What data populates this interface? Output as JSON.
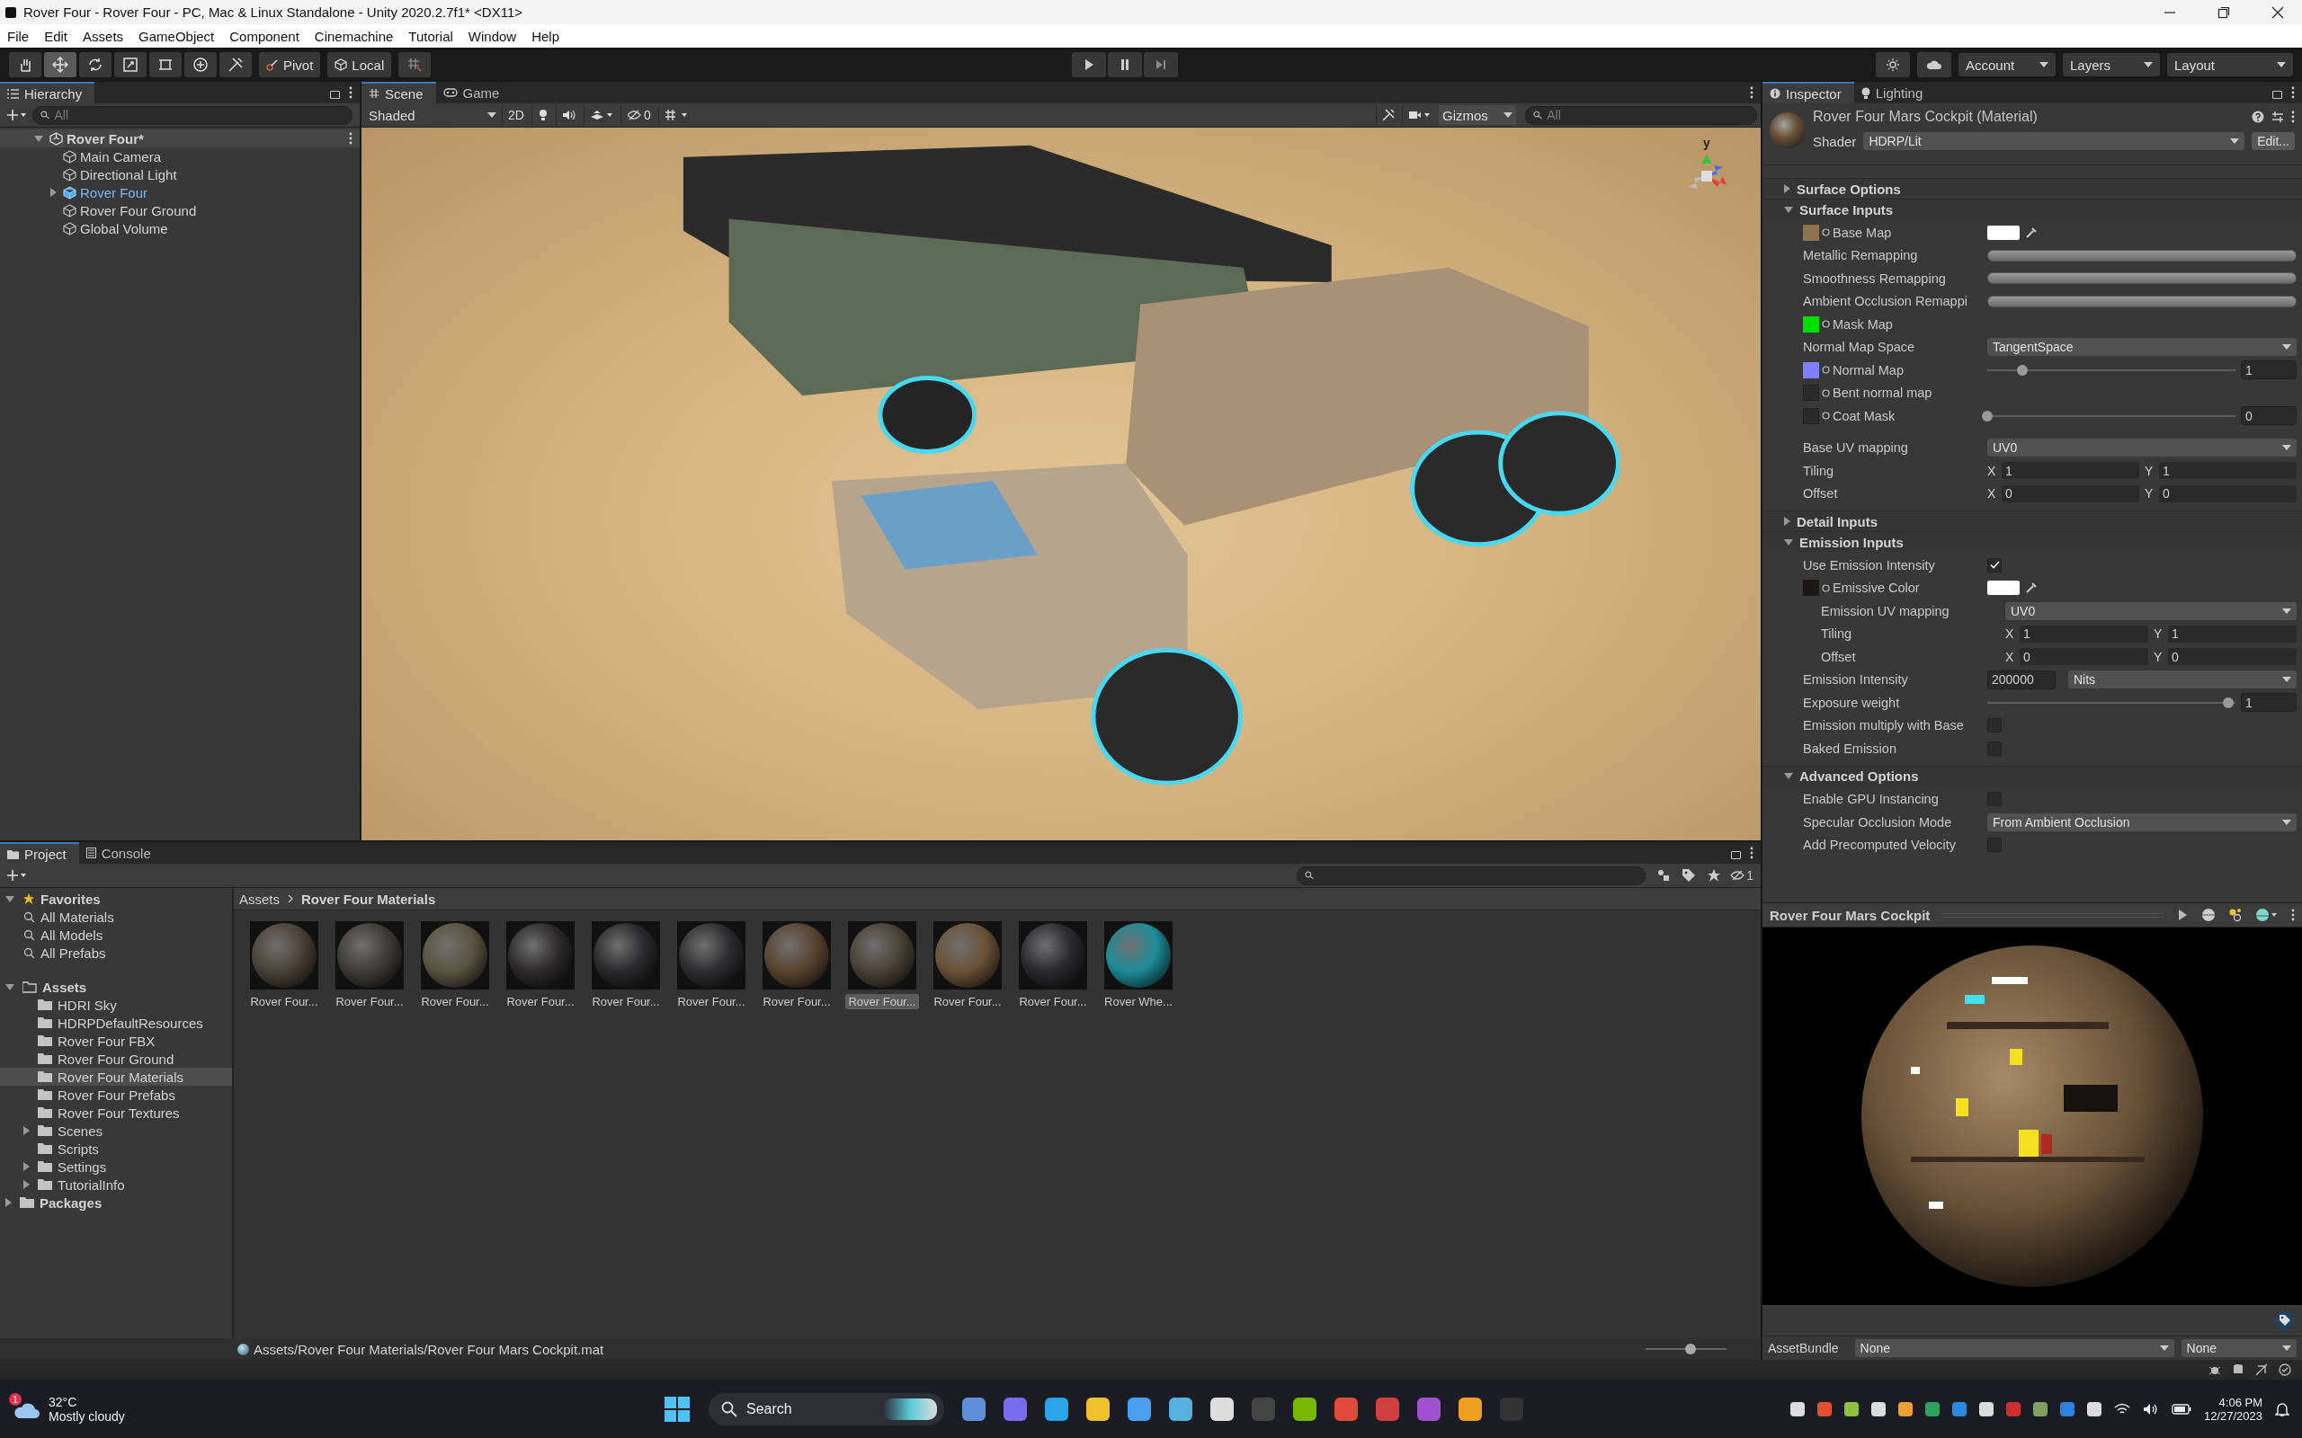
{
  "window": {
    "title": "Rover Four - Rover Four - PC, Mac & Linux Standalone - Unity 2020.2.7f1* <DX11>"
  },
  "menu": [
    "File",
    "Edit",
    "Assets",
    "GameObject",
    "Component",
    "Cinemachine",
    "Tutorial",
    "Window",
    "Help"
  ],
  "toolbar": {
    "tools": [
      {
        "kind": "hand",
        "selected": false
      },
      {
        "kind": "move",
        "selected": true
      },
      {
        "kind": "rotate",
        "selected": false
      },
      {
        "kind": "scale",
        "selected": false
      },
      {
        "kind": "rect",
        "selected": false
      },
      {
        "kind": "transform",
        "selected": false
      },
      {
        "kind": "custom",
        "selected": false
      }
    ],
    "pivot": "Pivot",
    "space": "Local",
    "account": "Account",
    "layers": "Layers",
    "layout": "Layout"
  },
  "hierarchy": {
    "title": "Hierarchy",
    "search": {
      "placeholder": "All"
    },
    "root": {
      "label": "Rover Four*",
      "expanded": true,
      "children": [
        {
          "label": "Main Camera",
          "kind": "object"
        },
        {
          "label": "Directional Light",
          "kind": "object"
        },
        {
          "label": "Rover Four",
          "kind": "prefab",
          "expanded": false
        },
        {
          "label": "Rover Four Ground",
          "kind": "object"
        },
        {
          "label": "Global Volume",
          "kind": "object"
        }
      ]
    }
  },
  "scene": {
    "tabs": [
      {
        "label": "Scene",
        "selected": true
      },
      {
        "label": "Game",
        "selected": false
      }
    ],
    "shading": "Shaded",
    "mode_2d": "2D",
    "hidden_count": "0",
    "gizmos": "Gizmos",
    "search": {
      "placeholder": "All"
    },
    "gizmo_axis": "y"
  },
  "inspector": {
    "tabs": [
      {
        "label": "Inspector",
        "selected": true
      },
      {
        "label": "Lighting",
        "selected": false
      }
    ],
    "material_title": "Rover Four Mars Cockpit (Material)",
    "shader_label": "Shader",
    "shader": "HDRP/Lit",
    "edit_button": "Edit...",
    "sections": [
      {
        "title": "Surface Options",
        "expanded": false
      },
      {
        "title": "Surface Inputs",
        "expanded": true,
        "rows": [
          {
            "kind": "texture_color",
            "label": "Base Map",
            "color": "#8f7350"
          },
          {
            "kind": "minmax",
            "label": "Metallic Remapping",
            "level": 1
          },
          {
            "kind": "minmax",
            "label": "Smoothness Remapping",
            "level": 1
          },
          {
            "kind": "minmax",
            "label": "Ambient Occlusion Remappi",
            "level": 1
          },
          {
            "kind": "texture",
            "label": "Mask Map",
            "color": "#00e000"
          },
          {
            "kind": "dropdown",
            "label": "Normal Map Space",
            "value": "TangentSpace"
          },
          {
            "kind": "texture_slider",
            "label": "Normal Map",
            "color": "#8080ff",
            "level": 0.14,
            "value": "1"
          },
          {
            "kind": "texture",
            "label": "Bent normal map"
          },
          {
            "kind": "texture_slider",
            "label": "Coat Mask",
            "level": 0,
            "value": "0"
          },
          {
            "kind": "dropdown",
            "label": "Base UV mapping",
            "value": "UV0"
          },
          {
            "kind": "vector2",
            "label": "Tiling",
            "x": {
              "label": "X",
              "value": "1"
            },
            "y": {
              "label": "Y",
              "value": "1"
            }
          },
          {
            "kind": "vector2",
            "label": "Offset",
            "x": {
              "label": "X",
              "value": "0"
            },
            "y": {
              "label": "Y",
              "value": "0"
            }
          }
        ]
      },
      {
        "title": "Detail Inputs",
        "expanded": false
      },
      {
        "title": "Emission Inputs",
        "expanded": true,
        "rows": [
          {
            "kind": "checkbox",
            "label": "Use Emission Intensity",
            "checked": true
          },
          {
            "kind": "texture_color",
            "label": "Emissive Color",
            "color": "#1c1614",
            "children": [
              {
                "kind": "dropdown",
                "label": "Emission UV mapping",
                "value": "UV0"
              },
              {
                "kind": "vector2",
                "label": "Tiling",
                "x": {
                  "label": "X",
                  "value": "1"
                },
                "y": {
                  "label": "Y",
                  "value": "1"
                }
              },
              {
                "kind": "vector2",
                "label": "Offset",
                "x": {
                  "label": "X",
                  "value": "0"
                },
                "y": {
                  "label": "Y",
                  "value": "0"
                }
              }
            ]
          },
          {
            "kind": "number_dropdown",
            "label": "Emission Intensity",
            "value": "200000",
            "option": "Nits"
          },
          {
            "kind": "slider",
            "label": "Exposure weight",
            "level": 0.97,
            "value": "1"
          },
          {
            "kind": "checkbox",
            "label": "Emission multiply with Base",
            "checked": false
          },
          {
            "kind": "checkbox",
            "label": "Baked Emission",
            "checked": false
          }
        ]
      },
      {
        "title": "Advanced Options",
        "expanded": true,
        "rows": [
          {
            "kind": "checkbox",
            "label": "Enable GPU Instancing",
            "checked": false
          },
          {
            "kind": "dropdown",
            "label": "Specular Occlusion Mode",
            "value": "From Ambient Occlusion"
          },
          {
            "kind": "checkbox",
            "label": "Add Precomputed Velocity",
            "checked": false
          }
        ]
      }
    ]
  },
  "preview": {
    "title": "Rover Four Mars Cockpit"
  },
  "asset_bundle": {
    "label": "AssetBundle",
    "name": "None",
    "variant": "None"
  },
  "project": {
    "tabs": [
      {
        "label": "Project",
        "selected": true
      },
      {
        "label": "Console",
        "selected": false
      }
    ],
    "favorites": {
      "label": "Favorites",
      "expanded": true,
      "items": [
        "All Materials",
        "All Models",
        "All Prefabs"
      ]
    },
    "assets": {
      "label": "Assets",
      "expanded": true,
      "children": [
        {
          "label": "HDRI Sky",
          "selected": false
        },
        {
          "label": "HDRPDefaultResources",
          "selected": false
        },
        {
          "label": "Rover Four FBX",
          "selected": false
        },
        {
          "label": "Rover Four Ground",
          "selected": false
        },
        {
          "label": "Rover Four Materials",
          "selected": true
        },
        {
          "label": "Rover Four Prefabs",
          "selected": false
        },
        {
          "label": "Rover Four Textures",
          "selected": false
        },
        {
          "label": "Scenes",
          "selected": false,
          "expanded": false
        },
        {
          "label": "Scripts",
          "selected": false
        },
        {
          "label": "Settings",
          "selected": false,
          "expanded": false
        },
        {
          "label": "TutorialInfo",
          "selected": false,
          "expanded": false
        }
      ]
    },
    "packages": {
      "label": "Packages",
      "expanded": false
    },
    "breadcrumb": [
      "Assets",
      "Rover Four Materials"
    ],
    "hidden_count": "1",
    "items": [
      {
        "label": "Rover Four...",
        "selected": false,
        "color": "#4a4238"
      },
      {
        "label": "Rover Four...",
        "selected": false,
        "color": "#3e3c36"
      },
      {
        "label": "Rover Four...",
        "selected": false,
        "color": "#5a5440"
      },
      {
        "label": "Rover Four...",
        "selected": false,
        "color": "#2c2a2a"
      },
      {
        "label": "Rover Four...",
        "selected": false,
        "color": "#2a2a2c"
      },
      {
        "label": "Rover Four...",
        "selected": false,
        "color": "#2e2e30"
      },
      {
        "label": "Rover Four...",
        "selected": false,
        "color": "#5a4430"
      },
      {
        "label": "Rover Four...",
        "selected": true,
        "color": "#4a4236"
      },
      {
        "label": "Rover Four...",
        "selected": false,
        "color": "#6a5238"
      },
      {
        "label": "Rover Four...",
        "selected": false,
        "color": "#2a2a2e"
      },
      {
        "label": "Rover Whe...",
        "selected": false,
        "color": "#1c8c98"
      }
    ],
    "path": "Assets/Rover Four Materials/Rover Four Mars Cockpit.mat",
    "thumbnail_size": {
      "level": 0.55
    }
  },
  "taskbar": {
    "weather": {
      "badge": "1",
      "temperature": "32°C",
      "condition": "Mostly cloudy"
    },
    "search_label": "Search",
    "time": "4:06 PM",
    "date": "12/27/2023"
  }
}
